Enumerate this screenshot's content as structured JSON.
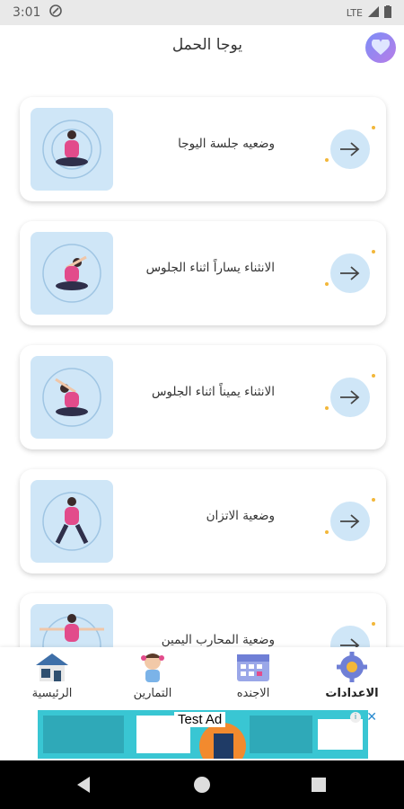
{
  "status": {
    "time": "3:01",
    "network": "LTE"
  },
  "header": {
    "title": "يوجا الحمل"
  },
  "exercises": [
    {
      "label": "وضعيه جلسة اليوجا"
    },
    {
      "label": "الانثناء يساراً اثناء الجلوس"
    },
    {
      "label": "الانثناء يميناً اثناء الجلوس"
    },
    {
      "label": "وضعية الاتزان"
    },
    {
      "label": "وضعية المحارب اليمين"
    }
  ],
  "nav": {
    "home": "الرئيسية",
    "exercises": "التمارين",
    "agenda": "الاجنده",
    "settings": "الاعدادات"
  },
  "ad": {
    "label": "Test Ad"
  },
  "colors": {
    "accent": "#cfe6f7",
    "ad_bg": "#39c6d3",
    "pink": "#e24b8b"
  }
}
